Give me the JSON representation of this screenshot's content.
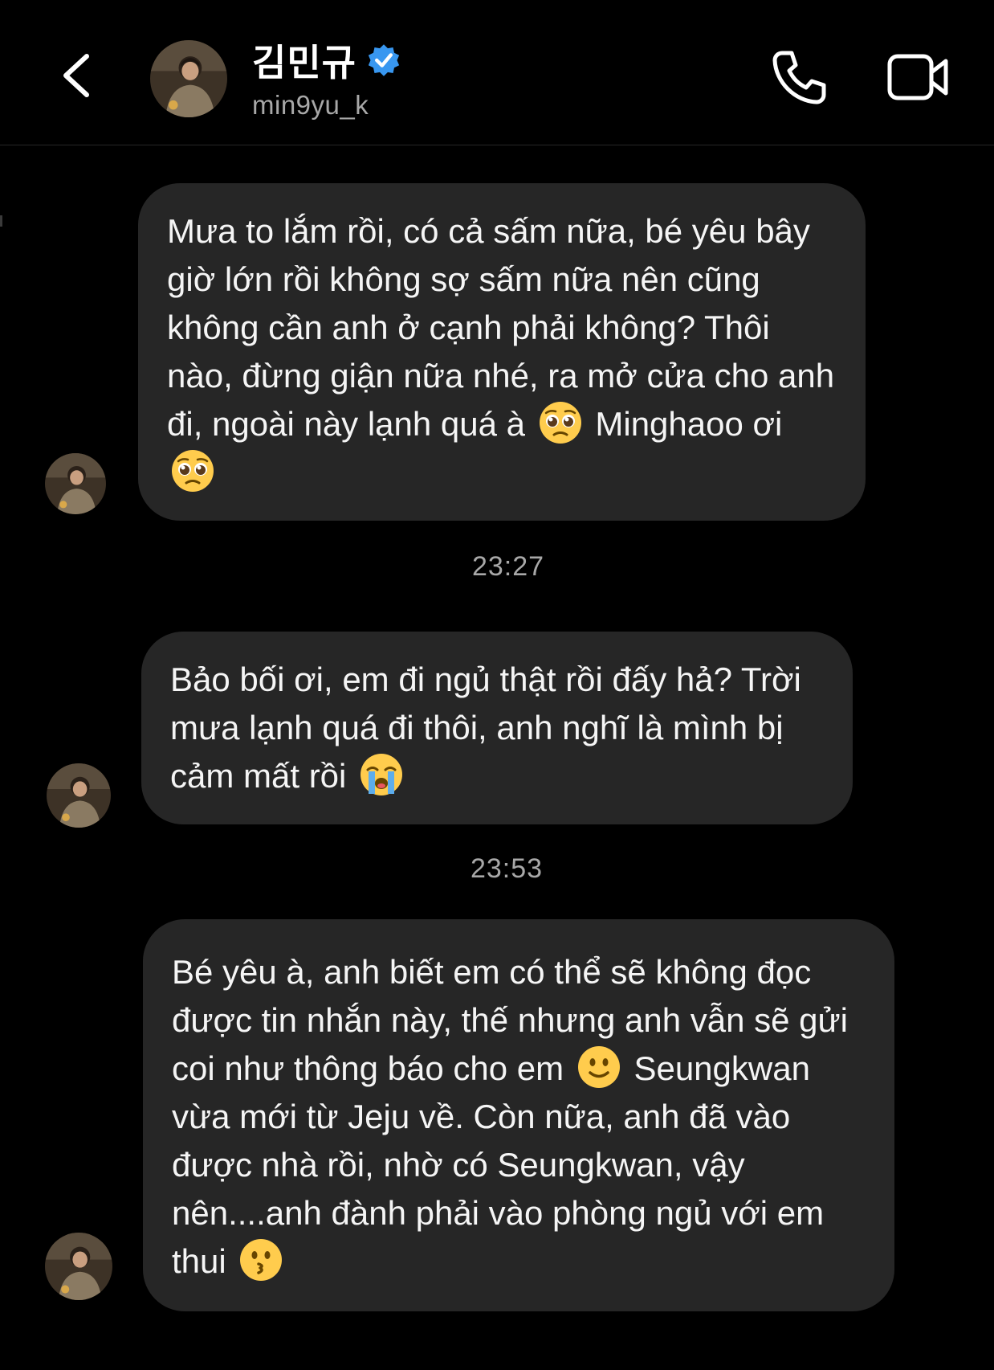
{
  "header": {
    "contact_name": "김민규",
    "username": "min9yu_k",
    "verified": true,
    "icons": [
      "back-chevron-icon",
      "verified-badge-icon",
      "phone-icon",
      "video-camera-icon"
    ]
  },
  "colors": {
    "background": "#000000",
    "bubble": "#262626",
    "text": "#f5f5f5",
    "secondary_text": "#a8a8a8",
    "verified_blue": "#3897f0",
    "emoji_yellow": "#ffcc4d"
  },
  "thread": {
    "messages": [
      {
        "parts": [
          "Mưa to lắm rồi, có cả sấm nữa, bé yêu bây giờ lớn rồi không sợ sấm nữa nên cũng không cần anh ở cạnh phải không? Thôi nào, đừng giận nữa nhé, ra mở cửa cho anh đi, ngoài này lạnh quá à",
          "Minghaoo ơi"
        ],
        "emojis": [
          "pleading-face-emoji",
          "pleading-face-emoji"
        ]
      },
      {
        "parts": [
          "Bảo bối ơi, em đi ngủ thật rồi đấy hả? Trời mưa lạnh quá đi thôi, anh nghĩ là mình bị cảm mất rồi"
        ],
        "emojis": [
          "loudly-crying-face-emoji"
        ]
      },
      {
        "parts": [
          "Bé yêu à, anh biết em có thể sẽ không đọc được tin nhắn này, thế nhưng anh vẫn sẽ gửi coi như thông báo cho em",
          "Seungkwan vừa mới từ Jeju về. Còn nữa, anh đã vào được nhà rồi, nhờ có Seungkwan, vậy nên....anh đành phải vào phòng ngủ với em thui"
        ],
        "emojis": [
          "slightly-smiling-face-emoji",
          "kissing-face-emoji"
        ]
      }
    ],
    "timestamps": [
      "23:27",
      "23:53"
    ]
  }
}
